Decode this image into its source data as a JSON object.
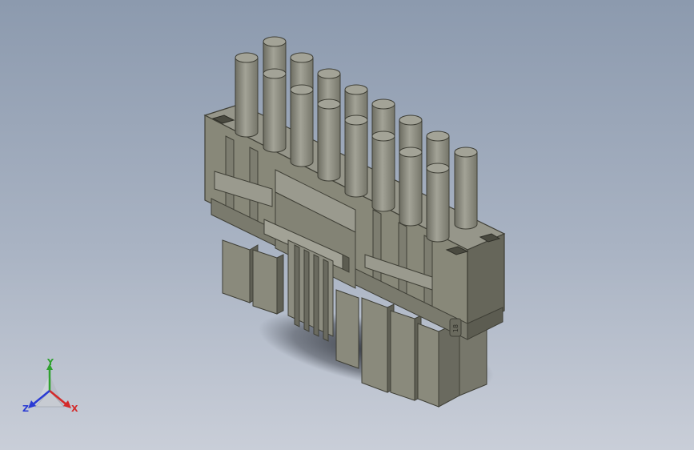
{
  "viewport": {
    "background_top": "#8c9aae",
    "background_bottom": "#c9ced8"
  },
  "model": {
    "body_color": "#8a8a7c",
    "shade_color": "#6e6e61",
    "dark_color": "#4d4d42",
    "pin_color": "#909084",
    "part_mark": "18"
  },
  "triad": {
    "x_label": "X",
    "y_label": "Y",
    "z_label": "Z",
    "x_color": "#d42a2a",
    "y_color": "#2fa12f",
    "z_color": "#2a3bd4"
  }
}
